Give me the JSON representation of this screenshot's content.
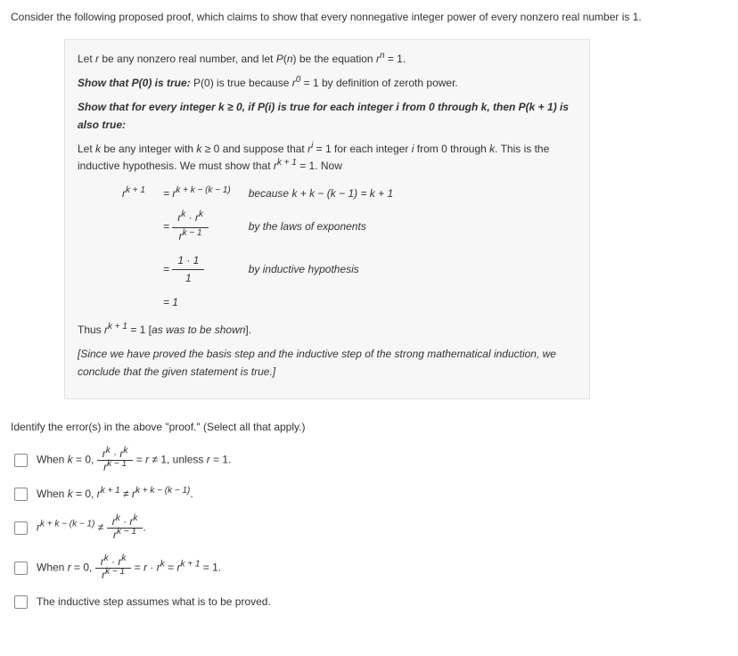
{
  "intro": "Consider the following proposed proof, which claims to show that every nonnegative integer power of every nonzero real number is 1.",
  "proof": {
    "p1_a": "Let ",
    "p1_b": " be any nonzero real number, and let ",
    "p1_c": " be the equation ",
    "p2_head": "Show that P(0) is true:",
    "p2_rest": " P(0) is true because ",
    "p2_tail": " = 1 by definition of zeroth power.",
    "p3_head": "Show that for every integer k ≥ 0, if P(i) is true for each integer i from 0 through k, then P(k + 1) is also true:",
    "p4_a": "Let ",
    "p4_b": " be any integer with ",
    "p4_c": " and suppose that ",
    "p4_d": " = 1 for each integer ",
    "p4_e": " from 0 through ",
    "p4_f": ". This is the inductive hypothesis. We must show that ",
    "p4_g": " = 1. Now",
    "eq": {
      "lhs": "r",
      "lhs_sup": "k + 1",
      "r1_rhs": "r",
      "r1_sup": "k + k − (k − 1)",
      "r1_reason": "because k + k − (k − 1) = k + 1",
      "r2_reason": "by the laws of exponents",
      "r3_num": "1 · 1",
      "r3_den": "1",
      "r3_reason": "by inductive hypothesis",
      "r4": "= 1"
    },
    "thus_a": "Thus ",
    "thus_b": " = 1 [",
    "thus_c": "as was to be shown",
    "thus_d": "].",
    "closing": "[Since we have proved the basis step and the inductive step of the strong mathematical induction, we conclude that the given statement is true.]"
  },
  "question": "Identify the error(s) in the above \"proof.\" (Select all that apply.)",
  "options": {
    "o1_a": "When ",
    "o1_b": " = 0, ",
    "o1_c": " = ",
    "o1_d": " ≠ 1, unless ",
    "o1_e": " = 1.",
    "o2_a": "When ",
    "o2_b": " = 0, ",
    "o2_c": " ≠ ",
    "o3_a": " ≠ ",
    "o4_a": "When ",
    "o4_b": " = 0, ",
    "o4_c": " = ",
    "o4_d": " = ",
    "o4_e": " = 1.",
    "o5": "The inductive step assumes what is to be proved."
  }
}
